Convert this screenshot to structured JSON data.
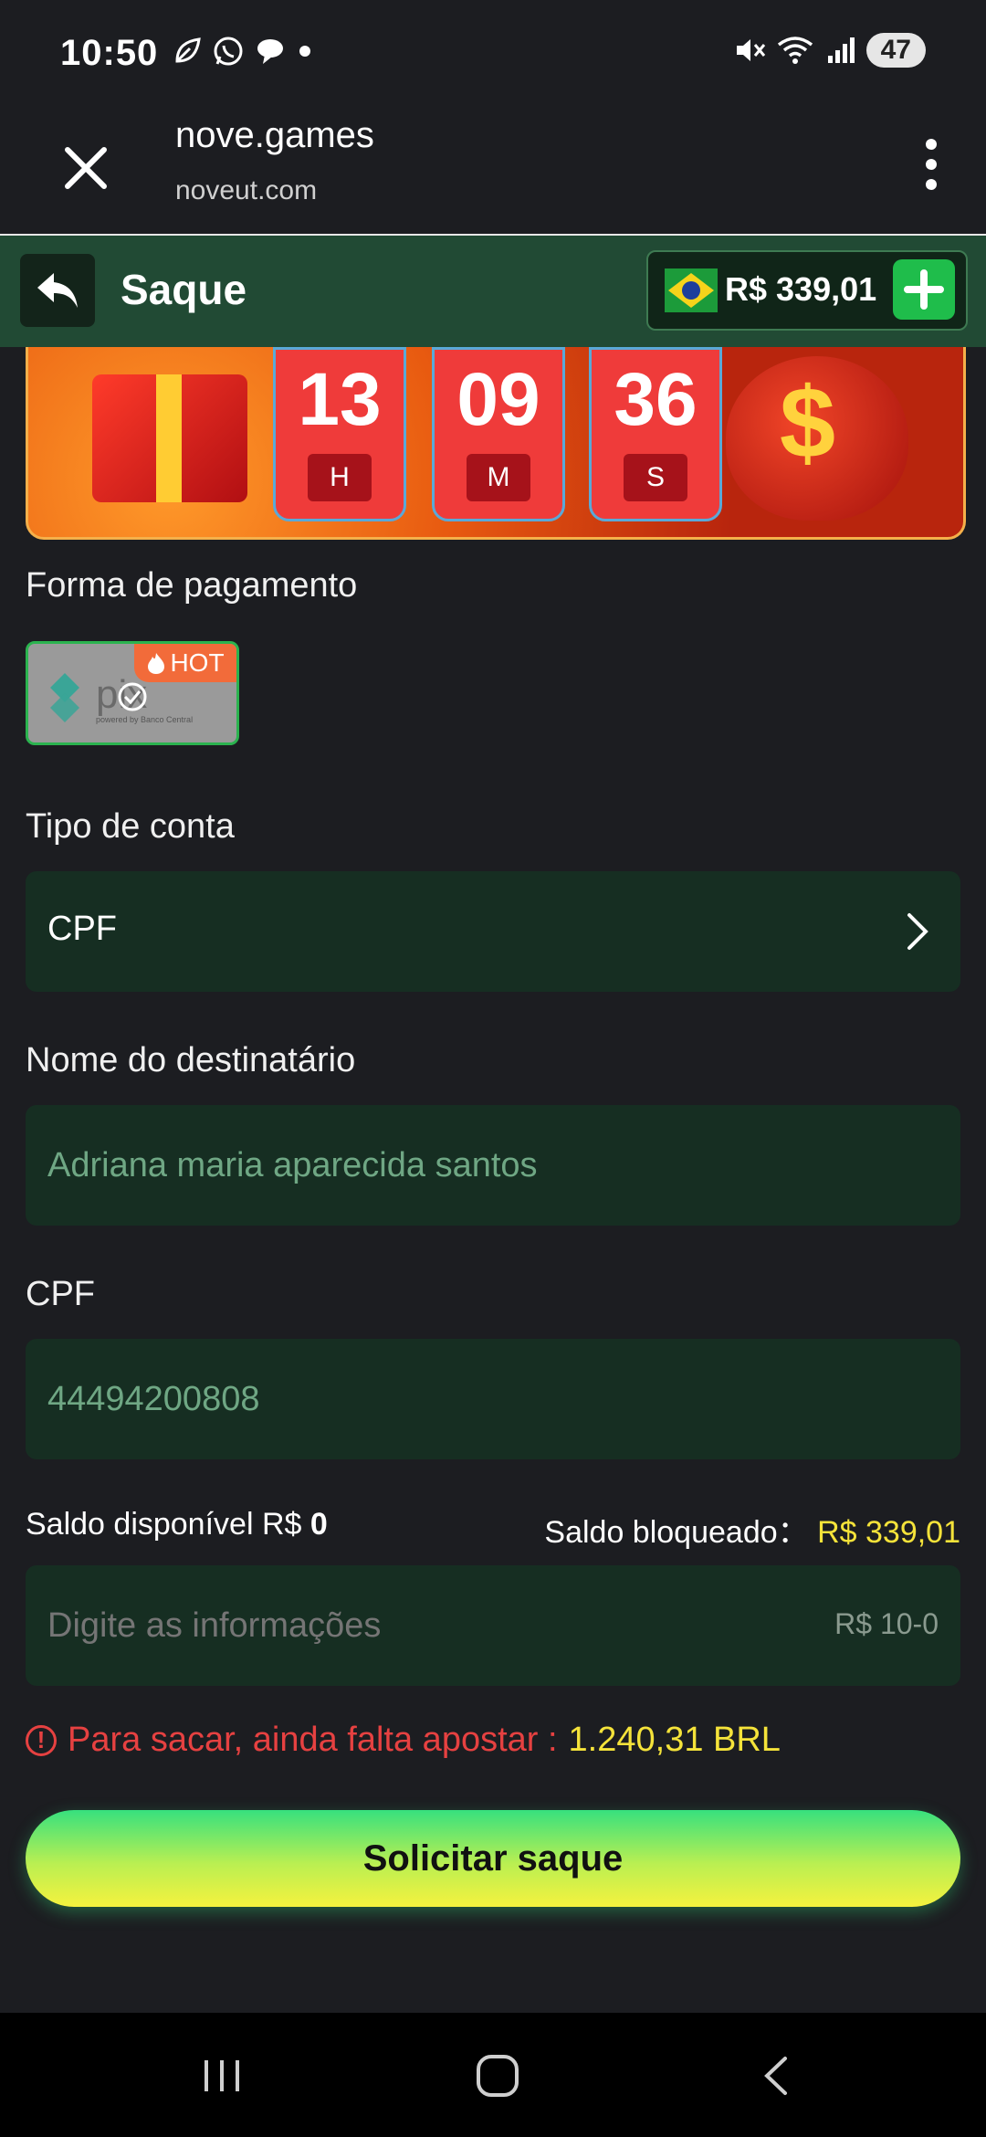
{
  "status_bar": {
    "time": "10:50",
    "battery": "47"
  },
  "browser": {
    "title": "nove.games",
    "url": "noveut.com"
  },
  "header": {
    "title": "Saque",
    "balance": "R$ 339,01"
  },
  "banner": {
    "hours": "13",
    "hours_label": "H",
    "minutes": "09",
    "minutes_label": "M",
    "seconds": "36",
    "seconds_label": "S"
  },
  "payment": {
    "label": "Forma de pagamento",
    "method": "pix",
    "method_tagline": "powered by Banco Central",
    "badge": "HOT"
  },
  "account_type": {
    "label": "Tipo de conta",
    "value": "CPF"
  },
  "recipient": {
    "label": "Nome do destinatário",
    "value": "Adriana maria aparecida santos"
  },
  "cpf": {
    "label": "CPF",
    "value": "44494200808"
  },
  "saldo": {
    "available_label": "Saldo disponível R$",
    "available_value": "0",
    "blocked_label": "Saldo bloqueado：",
    "blocked_value": "R$ 339,01"
  },
  "amount": {
    "placeholder": "Digite as informações",
    "range_hint": "R$ 10-0"
  },
  "warning": {
    "text": "Para sacar, ainda falta apostar :",
    "amount": "1.240,31 BRL"
  },
  "submit": {
    "label": "Solicitar saque"
  },
  "colors": {
    "accent_green": "#1fbd4b",
    "header_green": "#214a34",
    "field_bg": "#162e22",
    "warning_red": "#e64141",
    "highlight_yellow": "#f5e33a"
  }
}
